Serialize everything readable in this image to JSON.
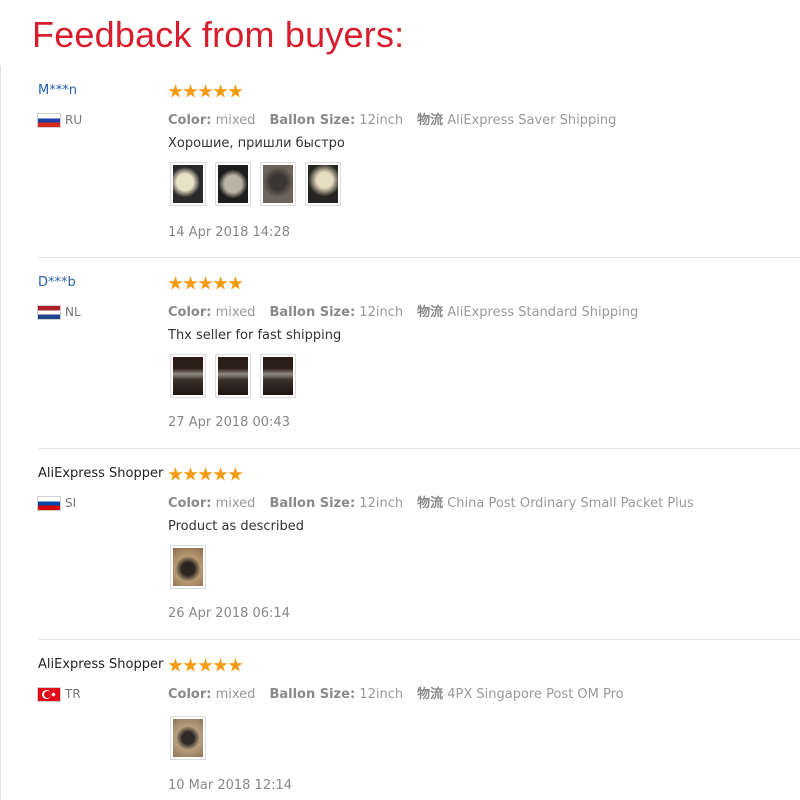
{
  "title": "Feedback from buyers:",
  "labels": {
    "color": "Color:",
    "size": "Ballon Size:",
    "ship": "物流"
  },
  "colors": {
    "title": "#d81e2c",
    "star": "#f39c12",
    "name_link": "#2a5fa8"
  },
  "reviews": [
    {
      "name": "M***n",
      "country": "RU",
      "flag": "russia-flag",
      "rating": 5,
      "color": "mixed",
      "size": "12inch",
      "shipping": "AliExpress Saver Shipping",
      "comment": "Хорошие, пришли быстро",
      "photo_count": 4,
      "date": "14 Apr 2018 14:28"
    },
    {
      "name": "D***b",
      "country": "NL",
      "flag": "netherlands-flag",
      "rating": 5,
      "color": "mixed",
      "size": "12inch",
      "shipping": "AliExpress Standard Shipping",
      "comment": "Thx seller for fast shipping",
      "photo_count": 3,
      "date": "27 Apr 2018 00:43"
    },
    {
      "name": "AliExpress Shopper",
      "country": "SI",
      "flag": "slovenia-flag",
      "rating": 5,
      "color": "mixed",
      "size": "12inch",
      "shipping": "China Post Ordinary Small Packet Plus",
      "comment": "Product as described",
      "photo_count": 1,
      "date": "26 Apr 2018 06:14"
    },
    {
      "name": "AliExpress Shopper",
      "country": "TR",
      "flag": "turkey-flag",
      "rating": 5,
      "color": "mixed",
      "size": "12inch",
      "shipping": "4PX Singapore Post OM Pro",
      "comment": "",
      "photo_count": 1,
      "date": "10 Mar 2018 12:14"
    }
  ]
}
